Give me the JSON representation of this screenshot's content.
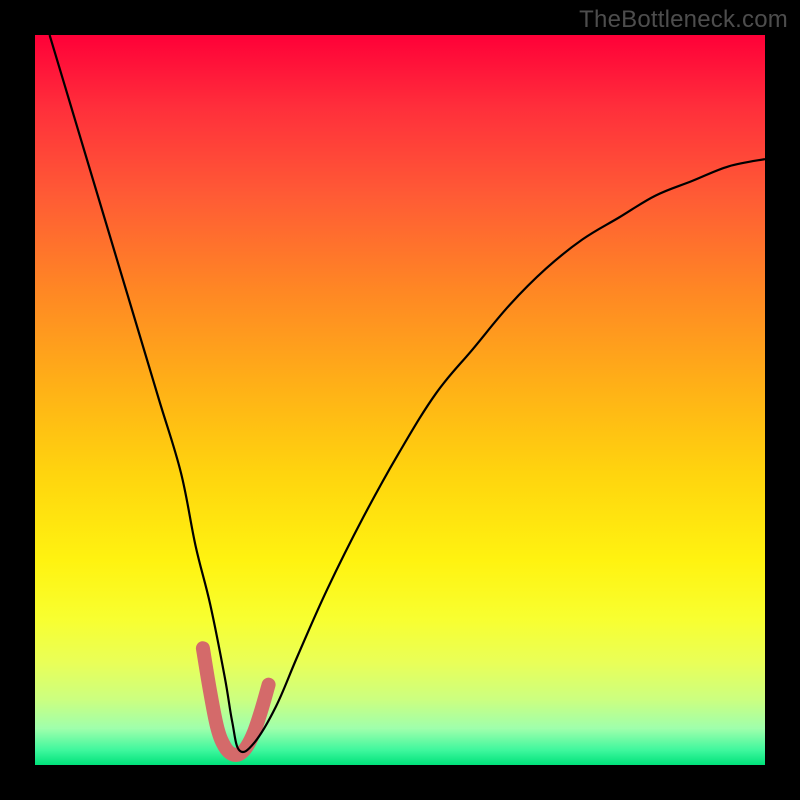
{
  "watermark": "TheBottleneck.com",
  "chart_data": {
    "type": "line",
    "title": "",
    "xlabel": "",
    "ylabel": "",
    "xlim": [
      0,
      100
    ],
    "ylim": [
      0,
      100
    ],
    "grid": false,
    "legend": false,
    "series": [
      {
        "name": "bottleneck-curve",
        "x": [
          2,
          5,
          8,
          11,
          14,
          17,
          20,
          22,
          24,
          26,
          27,
          28,
          30,
          33,
          36,
          40,
          45,
          50,
          55,
          60,
          65,
          70,
          75,
          80,
          85,
          90,
          95,
          100
        ],
        "values": [
          100,
          90,
          80,
          70,
          60,
          50,
          40,
          30,
          22,
          12,
          6,
          2,
          3,
          8,
          15,
          24,
          34,
          43,
          51,
          57,
          63,
          68,
          72,
          75,
          78,
          80,
          82,
          83
        ]
      },
      {
        "name": "highlight-segment",
        "x": [
          23,
          24,
          25,
          26,
          27,
          28,
          29,
          30,
          31,
          32
        ],
        "values": [
          16,
          10,
          5,
          2.5,
          1.5,
          1.5,
          2.5,
          4.5,
          7.5,
          11
        ]
      }
    ],
    "colors": {
      "curve": "#000000",
      "highlight": "#d46a6a",
      "gradient_top": "#ff0038",
      "gradient_bottom": "#00e27a"
    },
    "annotations": [
      {
        "text": "TheBottleneck.com",
        "position": "top-right"
      }
    ]
  }
}
